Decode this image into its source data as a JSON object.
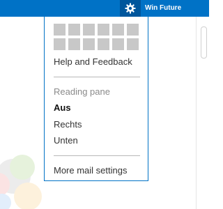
{
  "header": {
    "user_name": "Win Future",
    "settings_icon": "gear-icon",
    "accent_color": "#0072c6"
  },
  "settings_menu": {
    "theme_swatches": {
      "rows": 2,
      "per_row": 6
    },
    "help_label": "Help and Feedback",
    "reading_pane": {
      "heading": "Reading pane",
      "options": [
        "Aus",
        "Rechts",
        "Unten"
      ],
      "selected": "Aus"
    },
    "more_settings_label": "More mail settings"
  }
}
